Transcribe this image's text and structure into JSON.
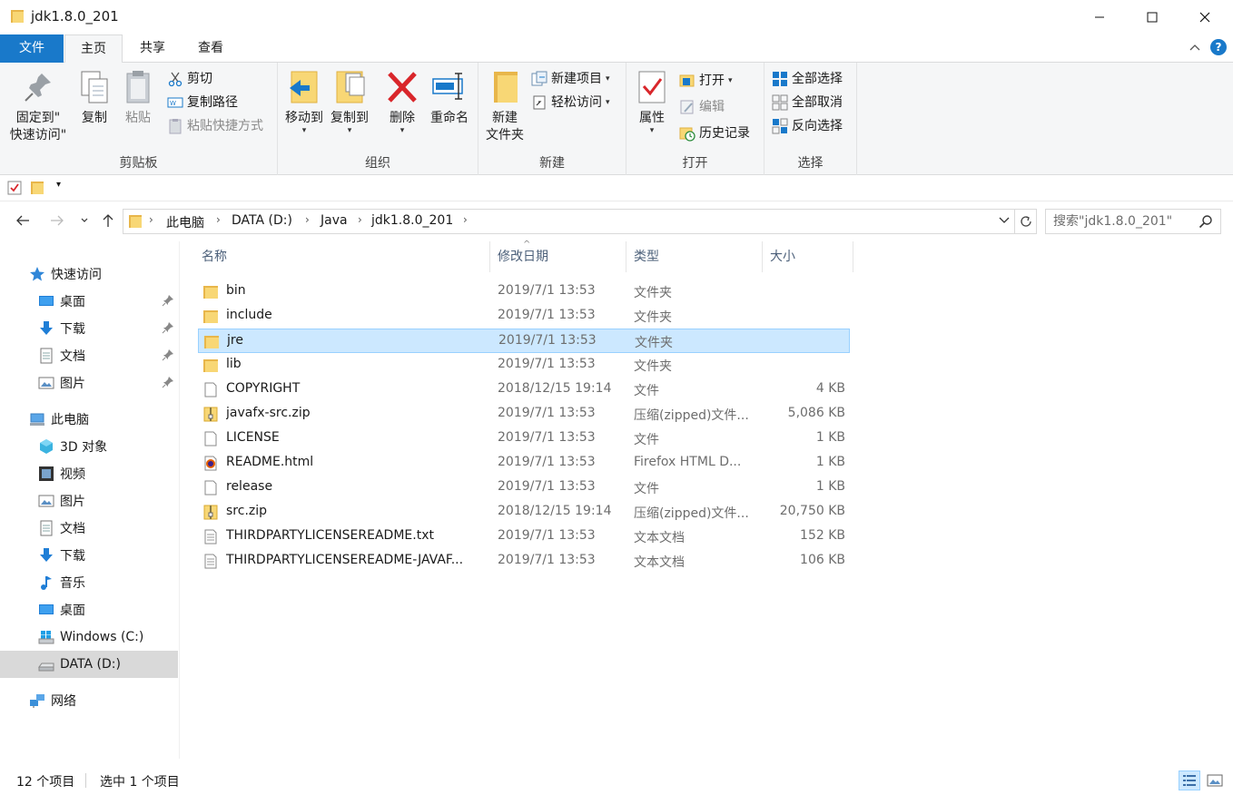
{
  "window": {
    "title": "jdk1.8.0_201"
  },
  "tabs": [
    {
      "label": "文件"
    },
    {
      "label": "主页"
    },
    {
      "label": "共享"
    },
    {
      "label": "查看"
    }
  ],
  "ribbon": {
    "clipboard": {
      "label": "剪贴板",
      "pin_line1": "固定到\"",
      "pin_line2": "快速访问\"",
      "copy": "复制",
      "paste": "粘贴",
      "cut": "剪切",
      "copy_path": "复制路径",
      "paste_shortcut": "粘贴快捷方式"
    },
    "organize": {
      "label": "组织",
      "move_to": "移动到",
      "copy_to": "复制到",
      "delete": "删除",
      "rename": "重命名"
    },
    "new": {
      "label": "新建",
      "new_folder_line1": "新建",
      "new_folder_line2": "文件夹",
      "new_item": "新建项目",
      "easy_access": "轻松访问"
    },
    "open": {
      "label": "打开",
      "properties": "属性",
      "open": "打开",
      "edit": "编辑",
      "history": "历史记录"
    },
    "select": {
      "label": "选择",
      "select_all": "全部选择",
      "select_none": "全部取消",
      "invert": "反向选择"
    }
  },
  "address": {
    "crumbs": [
      "此电脑",
      "DATA (D:)",
      "Java",
      "jdk1.8.0_201"
    ],
    "search_placeholder": "搜索\"jdk1.8.0_201\""
  },
  "navpane": {
    "quick_access": "快速访问",
    "quick_items": [
      {
        "label": "桌面"
      },
      {
        "label": "下载"
      },
      {
        "label": "文档"
      },
      {
        "label": "图片"
      }
    ],
    "this_pc": "此电脑",
    "pc_items": [
      {
        "label": "3D 对象"
      },
      {
        "label": "视频"
      },
      {
        "label": "图片"
      },
      {
        "label": "文档"
      },
      {
        "label": "下载"
      },
      {
        "label": "音乐"
      },
      {
        "label": "桌面"
      },
      {
        "label": "Windows (C:)"
      },
      {
        "label": "DATA (D:)"
      }
    ],
    "network": "网络"
  },
  "columns": {
    "name": "名称",
    "date": "修改日期",
    "type": "类型",
    "size": "大小"
  },
  "files": [
    {
      "name": "bin",
      "date": "2019/7/1 13:53",
      "type": "文件夹",
      "size": "",
      "icon": "folder-icon"
    },
    {
      "name": "include",
      "date": "2019/7/1 13:53",
      "type": "文件夹",
      "size": "",
      "icon": "folder-icon"
    },
    {
      "name": "jre",
      "date": "2019/7/1 13:53",
      "type": "文件夹",
      "size": "",
      "icon": "folder-icon"
    },
    {
      "name": "lib",
      "date": "2019/7/1 13:53",
      "type": "文件夹",
      "size": "",
      "icon": "folder-icon"
    },
    {
      "name": "COPYRIGHT",
      "date": "2018/12/15 19:14",
      "type": "文件",
      "size": "4 KB",
      "icon": "file-icon"
    },
    {
      "name": "javafx-src.zip",
      "date": "2019/7/1 13:53",
      "type": "压缩(zipped)文件...",
      "size": "5,086 KB",
      "icon": "zip-icon"
    },
    {
      "name": "LICENSE",
      "date": "2019/7/1 13:53",
      "type": "文件",
      "size": "1 KB",
      "icon": "file-icon"
    },
    {
      "name": "README.html",
      "date": "2019/7/1 13:53",
      "type": "Firefox HTML D...",
      "size": "1 KB",
      "icon": "firefox-html-icon"
    },
    {
      "name": "release",
      "date": "2019/7/1 13:53",
      "type": "文件",
      "size": "1 KB",
      "icon": "file-icon"
    },
    {
      "name": "src.zip",
      "date": "2018/12/15 19:14",
      "type": "压缩(zipped)文件...",
      "size": "20,750 KB",
      "icon": "zip-icon"
    },
    {
      "name": "THIRDPARTYLICENSEREADME.txt",
      "date": "2019/7/1 13:53",
      "type": "文本文档",
      "size": "152 KB",
      "icon": "text-file-icon"
    },
    {
      "name": "THIRDPARTYLICENSEREADME-JAVAF...",
      "date": "2019/7/1 13:53",
      "type": "文本文档",
      "size": "106 KB",
      "icon": "text-file-icon"
    }
  ],
  "status": {
    "item_count": "12 个项目",
    "selected": "选中 1 个项目"
  },
  "colors": {
    "accent": "#1979ca",
    "selection": "#cce8ff",
    "selection_border": "#99d1ff",
    "folder": "#f8d775"
  }
}
